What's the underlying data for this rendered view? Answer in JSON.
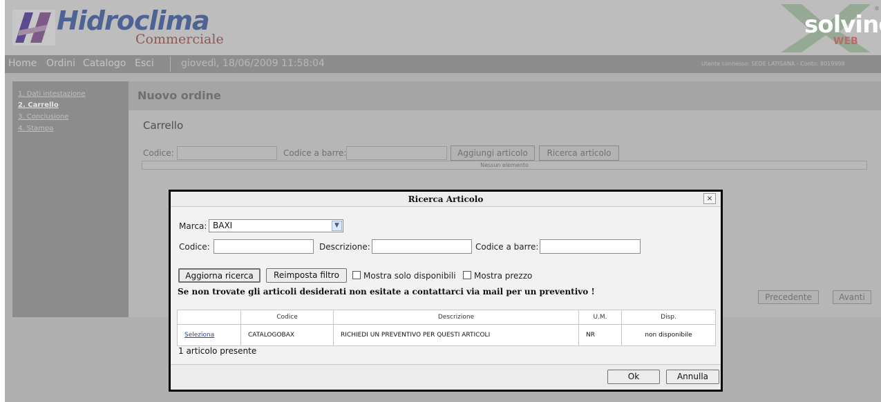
{
  "header": {
    "logo_name": "Hidroclima",
    "logo_sub": "Commerciale",
    "partner_logo": "solving",
    "partner_logo_sub": "WEB",
    "partner_logo_reg": "®"
  },
  "nav": {
    "home": "Home",
    "ordini": "Ordini",
    "catalogo": "Catalogo",
    "esci": "Esci",
    "date": "giovedì, 18/06/2009 11:58:04",
    "user": "Utente connesso: SEDE LATISANA - Conto: 8019999"
  },
  "sidebar": {
    "items": [
      {
        "label": "1. Dati intestazione"
      },
      {
        "label": "2. Carrello"
      },
      {
        "label": "3. Conclusione"
      },
      {
        "label": "4. Stampa"
      }
    ]
  },
  "main": {
    "title": "Nuovo ordine",
    "section": "Carrello",
    "codice_label": "Codice:",
    "barcode_label": "Codice a barre:",
    "add_button": "Aggiungi articolo",
    "search_button": "Ricerca articolo",
    "empty_text": "Nessun elemento",
    "prev_button": "Precedente",
    "next_button": "Avanti"
  },
  "dialog": {
    "title": "Ricerca Articolo",
    "close": "×",
    "marca_label": "Marca:",
    "marca_value": "BAXI",
    "codice_label": "Codice:",
    "descrizione_label": "Descrizione:",
    "barcode_label": "Codice a barre:",
    "update_button": "Aggiorna ricerca",
    "reset_button": "Reimposta filtro",
    "only_available_label": "Mostra solo disponibili",
    "show_price_label": "Mostra prezzo",
    "warning": "Se non trovate gli articoli desiderati non esitate a contattarci via mail per un preventivo !",
    "columns": [
      "",
      "Codice",
      "Descrizione",
      "U.M.",
      "Disp."
    ],
    "rows": [
      {
        "action": "Seleziona",
        "codice": "CATALOGOBAX",
        "descrizione": "RICHIEDI UN PREVENTIVO PER QUESTI ARTICOLI",
        "um": "NR",
        "disp": "non disponibile"
      }
    ],
    "count_text": "1 articolo presente",
    "ok_button": "Ok",
    "cancel_button": "Annulla"
  }
}
